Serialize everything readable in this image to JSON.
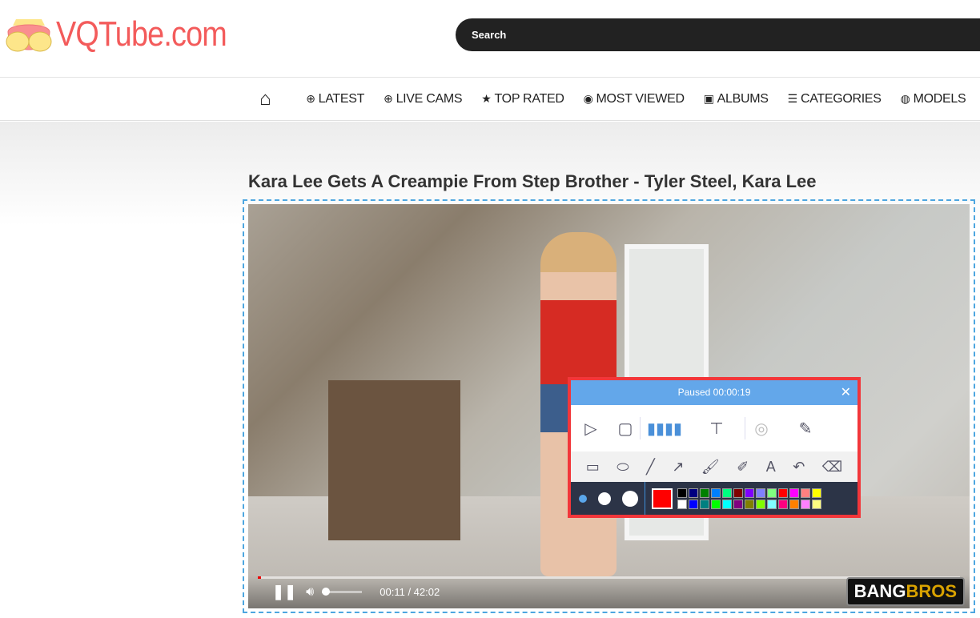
{
  "site": {
    "logo": "VQTube.com",
    "search_placeholder": "Search"
  },
  "nav": [
    {
      "label": "",
      "icon": "home-icon",
      "glyph": "⌂"
    },
    {
      "label": "LATEST",
      "icon": "plus-circle-icon",
      "glyph": "⊕"
    },
    {
      "label": "LIVE CAMS",
      "icon": "plus-circle-icon",
      "glyph": "⊕"
    },
    {
      "label": "TOP RATED",
      "icon": "star-icon",
      "glyph": "★"
    },
    {
      "label": "MOST VIEWED",
      "icon": "eye-icon",
      "glyph": "◉"
    },
    {
      "label": "ALBUMS",
      "icon": "image-icon",
      "glyph": "▣"
    },
    {
      "label": "CATEGORIES",
      "icon": "list-icon",
      "glyph": "☰"
    },
    {
      "label": "MODELS",
      "icon": "user-circle-icon",
      "glyph": "◍"
    }
  ],
  "video": {
    "title": "Kara Lee Gets A Creampie From Step Brother - Tyler Steel, Kara Lee",
    "time": "00:11 / 42:02",
    "progress_percent": 0.44,
    "volume_fraction": 0.1,
    "watermark_a": "BANG",
    "watermark_b": "BROS"
  },
  "recorder": {
    "status": "Paused 00:00:19",
    "accent": "#63a7ea",
    "border": "#f2363a",
    "current_color": "#ff0000",
    "palette": [
      "#000000",
      "#000080",
      "#008000",
      "#0080ff",
      "#00ff80",
      "#800000",
      "#8000ff",
      "#8080ff",
      "#80ff80",
      "#ff0000",
      "#ff00ff",
      "#ff8080",
      "#ffff00",
      "#ffffff",
      "#0000ff",
      "#008080",
      "#00ff00",
      "#00ffff",
      "#800080",
      "#808000",
      "#80ff00",
      "#80ffff",
      "#ff0080",
      "#ff8000",
      "#ff80ff",
      "#ffff80"
    ]
  }
}
